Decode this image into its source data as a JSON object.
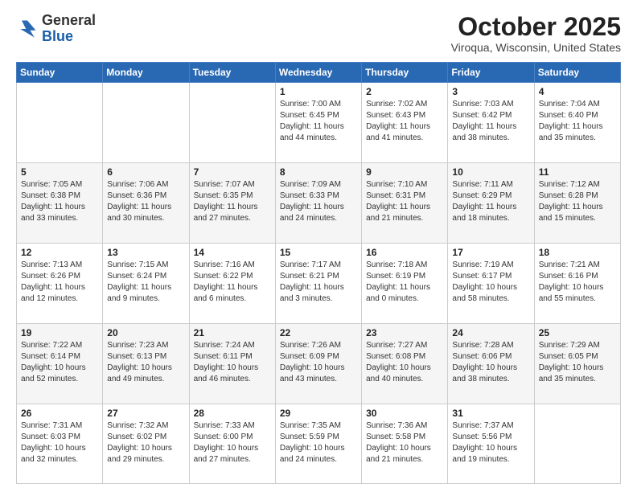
{
  "header": {
    "logo_general": "General",
    "logo_blue": "Blue",
    "month": "October 2025",
    "location": "Viroqua, Wisconsin, United States"
  },
  "weekdays": [
    "Sunday",
    "Monday",
    "Tuesday",
    "Wednesday",
    "Thursday",
    "Friday",
    "Saturday"
  ],
  "weeks": [
    [
      {
        "day": "",
        "sunrise": "",
        "sunset": "",
        "daylight": ""
      },
      {
        "day": "",
        "sunrise": "",
        "sunset": "",
        "daylight": ""
      },
      {
        "day": "",
        "sunrise": "",
        "sunset": "",
        "daylight": ""
      },
      {
        "day": "1",
        "sunrise": "Sunrise: 7:00 AM",
        "sunset": "Sunset: 6:45 PM",
        "daylight": "Daylight: 11 hours and 44 minutes."
      },
      {
        "day": "2",
        "sunrise": "Sunrise: 7:02 AM",
        "sunset": "Sunset: 6:43 PM",
        "daylight": "Daylight: 11 hours and 41 minutes."
      },
      {
        "day": "3",
        "sunrise": "Sunrise: 7:03 AM",
        "sunset": "Sunset: 6:42 PM",
        "daylight": "Daylight: 11 hours and 38 minutes."
      },
      {
        "day": "4",
        "sunrise": "Sunrise: 7:04 AM",
        "sunset": "Sunset: 6:40 PM",
        "daylight": "Daylight: 11 hours and 35 minutes."
      }
    ],
    [
      {
        "day": "5",
        "sunrise": "Sunrise: 7:05 AM",
        "sunset": "Sunset: 6:38 PM",
        "daylight": "Daylight: 11 hours and 33 minutes."
      },
      {
        "day": "6",
        "sunrise": "Sunrise: 7:06 AM",
        "sunset": "Sunset: 6:36 PM",
        "daylight": "Daylight: 11 hours and 30 minutes."
      },
      {
        "day": "7",
        "sunrise": "Sunrise: 7:07 AM",
        "sunset": "Sunset: 6:35 PM",
        "daylight": "Daylight: 11 hours and 27 minutes."
      },
      {
        "day": "8",
        "sunrise": "Sunrise: 7:09 AM",
        "sunset": "Sunset: 6:33 PM",
        "daylight": "Daylight: 11 hours and 24 minutes."
      },
      {
        "day": "9",
        "sunrise": "Sunrise: 7:10 AM",
        "sunset": "Sunset: 6:31 PM",
        "daylight": "Daylight: 11 hours and 21 minutes."
      },
      {
        "day": "10",
        "sunrise": "Sunrise: 7:11 AM",
        "sunset": "Sunset: 6:29 PM",
        "daylight": "Daylight: 11 hours and 18 minutes."
      },
      {
        "day": "11",
        "sunrise": "Sunrise: 7:12 AM",
        "sunset": "Sunset: 6:28 PM",
        "daylight": "Daylight: 11 hours and 15 minutes."
      }
    ],
    [
      {
        "day": "12",
        "sunrise": "Sunrise: 7:13 AM",
        "sunset": "Sunset: 6:26 PM",
        "daylight": "Daylight: 11 hours and 12 minutes."
      },
      {
        "day": "13",
        "sunrise": "Sunrise: 7:15 AM",
        "sunset": "Sunset: 6:24 PM",
        "daylight": "Daylight: 11 hours and 9 minutes."
      },
      {
        "day": "14",
        "sunrise": "Sunrise: 7:16 AM",
        "sunset": "Sunset: 6:22 PM",
        "daylight": "Daylight: 11 hours and 6 minutes."
      },
      {
        "day": "15",
        "sunrise": "Sunrise: 7:17 AM",
        "sunset": "Sunset: 6:21 PM",
        "daylight": "Daylight: 11 hours and 3 minutes."
      },
      {
        "day": "16",
        "sunrise": "Sunrise: 7:18 AM",
        "sunset": "Sunset: 6:19 PM",
        "daylight": "Daylight: 11 hours and 0 minutes."
      },
      {
        "day": "17",
        "sunrise": "Sunrise: 7:19 AM",
        "sunset": "Sunset: 6:17 PM",
        "daylight": "Daylight: 10 hours and 58 minutes."
      },
      {
        "day": "18",
        "sunrise": "Sunrise: 7:21 AM",
        "sunset": "Sunset: 6:16 PM",
        "daylight": "Daylight: 10 hours and 55 minutes."
      }
    ],
    [
      {
        "day": "19",
        "sunrise": "Sunrise: 7:22 AM",
        "sunset": "Sunset: 6:14 PM",
        "daylight": "Daylight: 10 hours and 52 minutes."
      },
      {
        "day": "20",
        "sunrise": "Sunrise: 7:23 AM",
        "sunset": "Sunset: 6:13 PM",
        "daylight": "Daylight: 10 hours and 49 minutes."
      },
      {
        "day": "21",
        "sunrise": "Sunrise: 7:24 AM",
        "sunset": "Sunset: 6:11 PM",
        "daylight": "Daylight: 10 hours and 46 minutes."
      },
      {
        "day": "22",
        "sunrise": "Sunrise: 7:26 AM",
        "sunset": "Sunset: 6:09 PM",
        "daylight": "Daylight: 10 hours and 43 minutes."
      },
      {
        "day": "23",
        "sunrise": "Sunrise: 7:27 AM",
        "sunset": "Sunset: 6:08 PM",
        "daylight": "Daylight: 10 hours and 40 minutes."
      },
      {
        "day": "24",
        "sunrise": "Sunrise: 7:28 AM",
        "sunset": "Sunset: 6:06 PM",
        "daylight": "Daylight: 10 hours and 38 minutes."
      },
      {
        "day": "25",
        "sunrise": "Sunrise: 7:29 AM",
        "sunset": "Sunset: 6:05 PM",
        "daylight": "Daylight: 10 hours and 35 minutes."
      }
    ],
    [
      {
        "day": "26",
        "sunrise": "Sunrise: 7:31 AM",
        "sunset": "Sunset: 6:03 PM",
        "daylight": "Daylight: 10 hours and 32 minutes."
      },
      {
        "day": "27",
        "sunrise": "Sunrise: 7:32 AM",
        "sunset": "Sunset: 6:02 PM",
        "daylight": "Daylight: 10 hours and 29 minutes."
      },
      {
        "day": "28",
        "sunrise": "Sunrise: 7:33 AM",
        "sunset": "Sunset: 6:00 PM",
        "daylight": "Daylight: 10 hours and 27 minutes."
      },
      {
        "day": "29",
        "sunrise": "Sunrise: 7:35 AM",
        "sunset": "Sunset: 5:59 PM",
        "daylight": "Daylight: 10 hours and 24 minutes."
      },
      {
        "day": "30",
        "sunrise": "Sunrise: 7:36 AM",
        "sunset": "Sunset: 5:58 PM",
        "daylight": "Daylight: 10 hours and 21 minutes."
      },
      {
        "day": "31",
        "sunrise": "Sunrise: 7:37 AM",
        "sunset": "Sunset: 5:56 PM",
        "daylight": "Daylight: 10 hours and 19 minutes."
      },
      {
        "day": "",
        "sunrise": "",
        "sunset": "",
        "daylight": ""
      }
    ]
  ]
}
